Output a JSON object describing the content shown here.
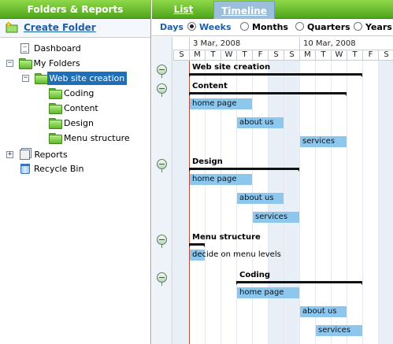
{
  "left_panel": {
    "title": "Folders & Reports",
    "create_folder": "Create Folder",
    "tree": {
      "dashboard": "Dashboard",
      "my_folders": "My Folders",
      "web_site_creation": "Web site creation",
      "coding": "Coding",
      "content": "Content",
      "design": "Design",
      "menu_structure": "Menu structure",
      "reports": "Reports",
      "recycle_bin": "Recycle Bin"
    }
  },
  "tabs": {
    "list": "List",
    "timeline": "Timeline"
  },
  "scale": {
    "label": "Days",
    "weeks": "Weeks",
    "months": "Months",
    "quarters": "Quarters",
    "years": "Years",
    "selected": "weeks"
  },
  "timeline": {
    "weeks": [
      "3 Mar, 2008",
      "10 Mar, 2008"
    ],
    "day_letters": [
      "S",
      "M",
      "T",
      "W",
      "T",
      "F",
      "S",
      "S",
      "M",
      "T",
      "W",
      "T",
      "F",
      "S"
    ],
    "groups": {
      "web_site_creation": "Web site creation",
      "content": "Content",
      "design": "Design",
      "menu_structure": "Menu structure",
      "coding": "Coding"
    },
    "tasks": {
      "content_home": "home page",
      "content_about": "about us",
      "content_services": "services",
      "design_home": "home page",
      "design_about": "about us",
      "design_services": "services",
      "menu_decide": "decide on menu levels",
      "coding_home": "home page",
      "coding_about": "about us",
      "coding_services": "services"
    }
  },
  "colors": {
    "header_green": "#4fa51a",
    "active_tab": "#9bbfda",
    "task_bar": "#8ec7ee",
    "selection": "#1f6fb8",
    "today_line": "#b5543a"
  }
}
